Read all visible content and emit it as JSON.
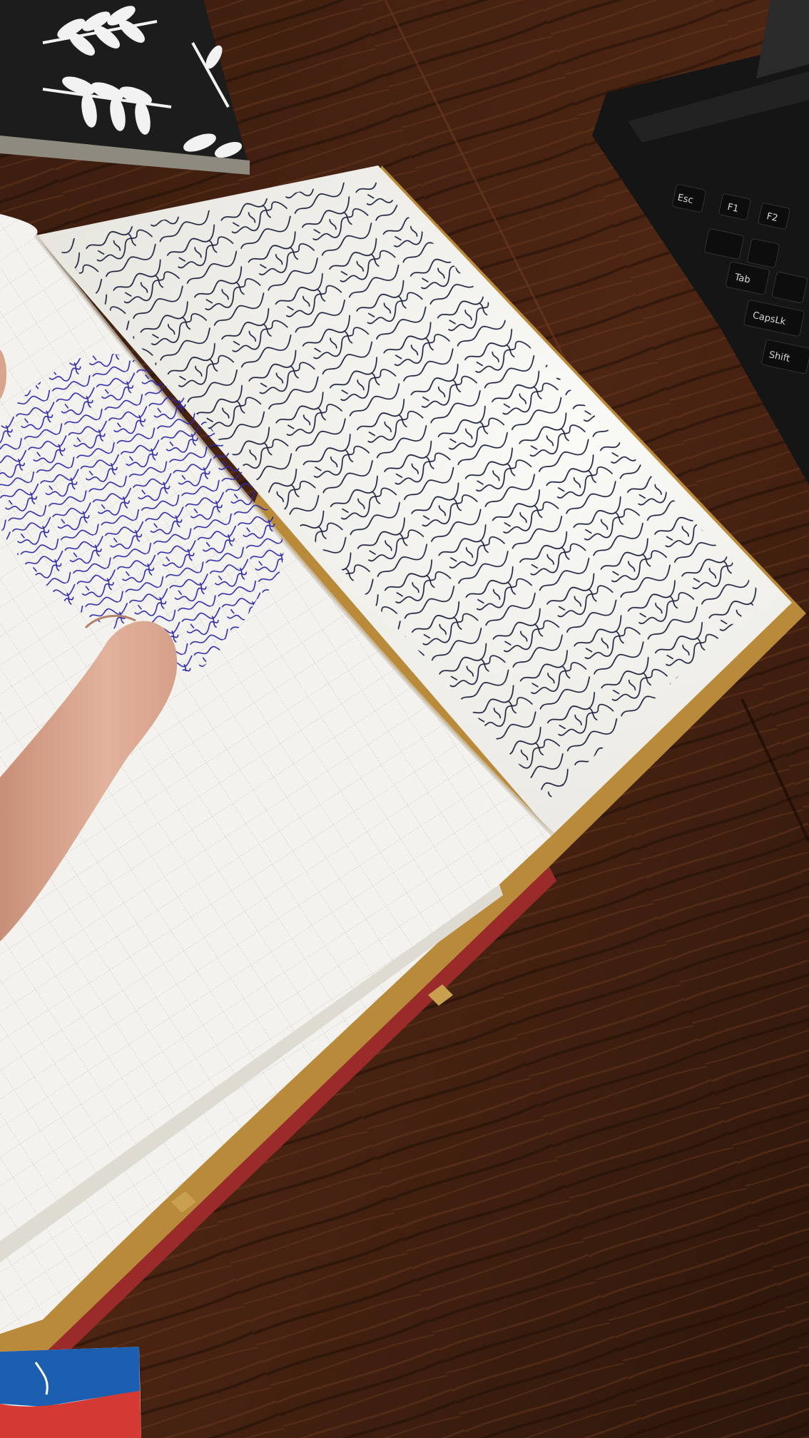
{
  "scene": {
    "subject": "open-notebook-with-pen-doodles",
    "colors": {
      "table_wood_dark": "#2b150b",
      "table_wood_mid": "#4a2412",
      "table_wood_light": "#6b3a20",
      "paper_white": "#f4f3ef",
      "paper_shadow": "#dcdad3",
      "grid_line": "#b9b6ad",
      "ink_black_blue": "#1f2340",
      "ink_blue": "#2a25a0",
      "cover_gold": "#b88a3a",
      "spine_red": "#9b2a2a",
      "laptop_black": "#151515",
      "finger_skin": "#d9a48c",
      "notebook_black_cover": "#1c1c1c",
      "leaf_white": "#f2f2f2"
    }
  },
  "laptop": {
    "keys": [
      {
        "label": "Esc"
      },
      {
        "label": "F1"
      },
      {
        "label": "F2"
      },
      {
        "label": "Tab"
      },
      {
        "label": "CapsLk"
      },
      {
        "label": "Shift"
      }
    ]
  },
  "icons": {
    "leaf_pattern": "leaf-icon",
    "doodle_right_page": "squiggle-doodle-icon",
    "doodle_left_page": "blue-squiggle-doodle-icon"
  }
}
